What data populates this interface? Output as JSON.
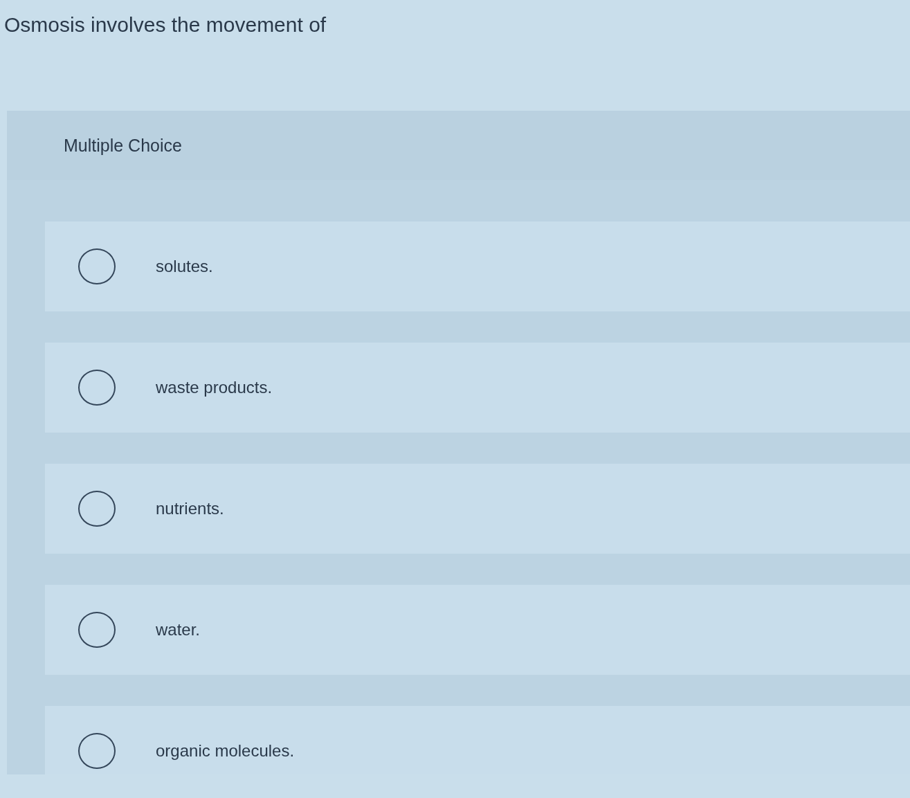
{
  "question": "Osmosis involves the movement of",
  "answer_panel": {
    "heading": "Multiple Choice",
    "options": [
      {
        "label": "solutes.",
        "selected": false
      },
      {
        "label": "waste products.",
        "selected": false
      },
      {
        "label": "nutrients.",
        "selected": false
      },
      {
        "label": "water.",
        "selected": false
      },
      {
        "label": "organic molecules.",
        "selected": false
      }
    ]
  }
}
